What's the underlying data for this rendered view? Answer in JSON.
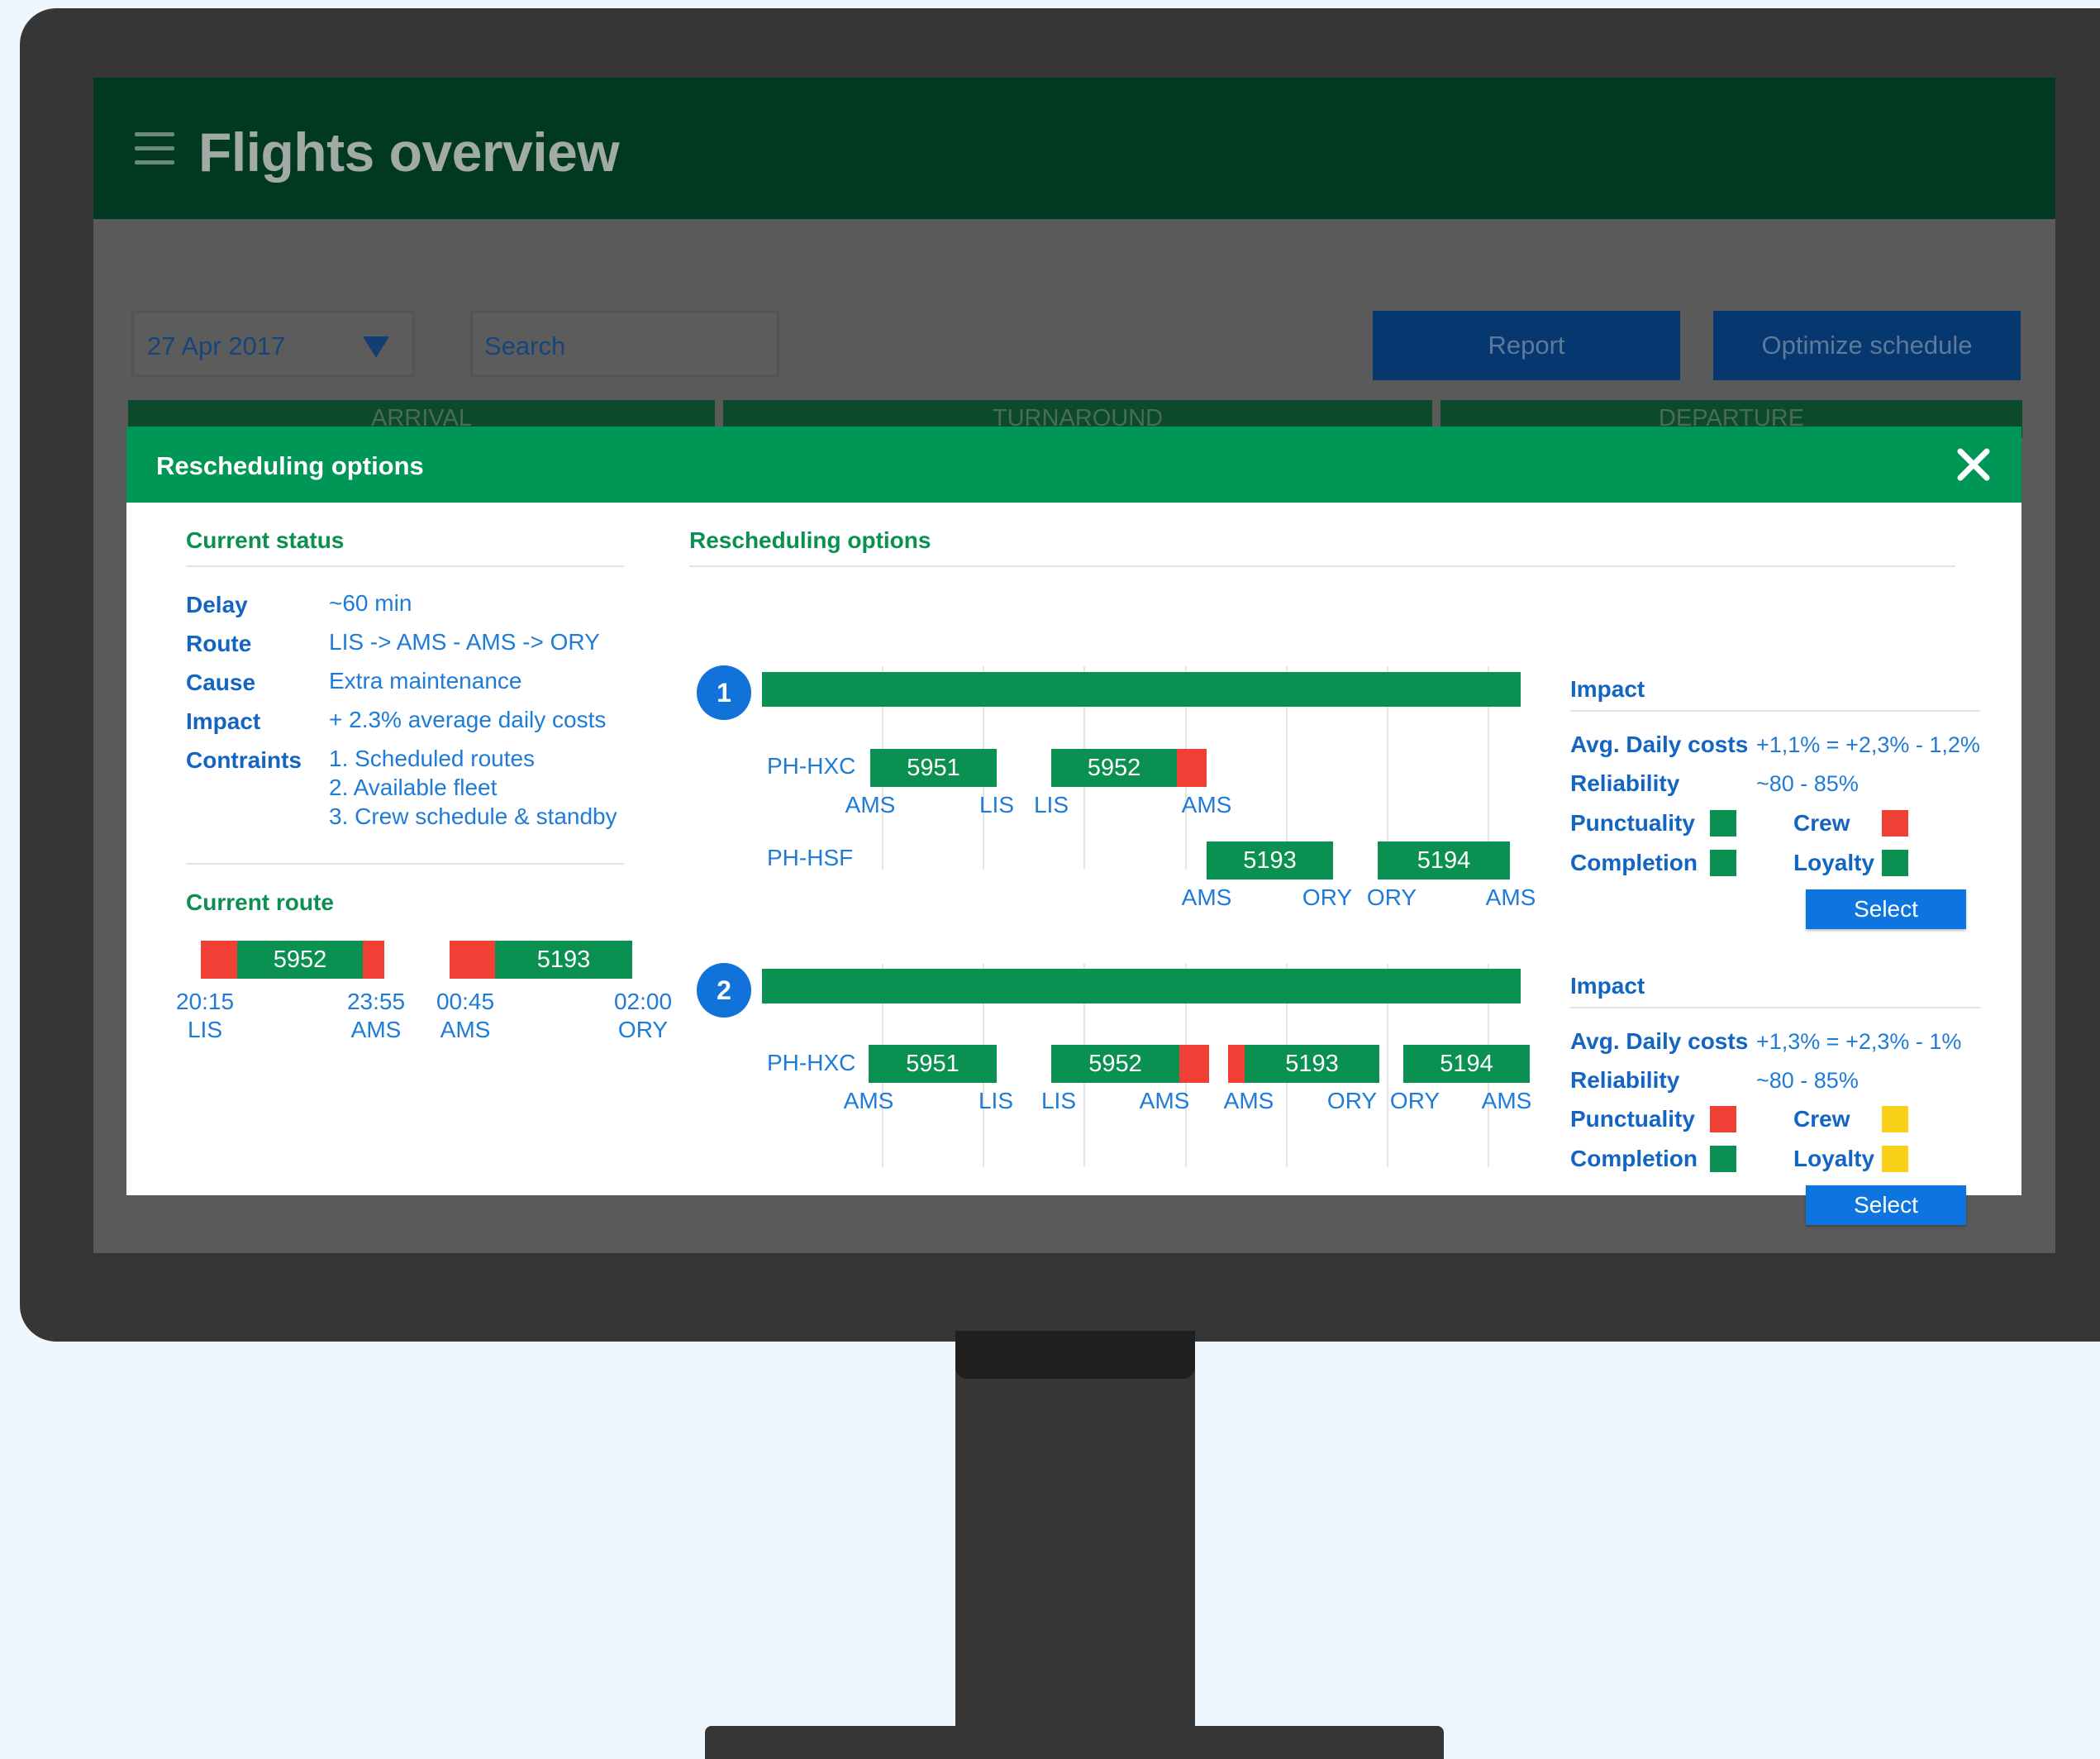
{
  "app": {
    "title": "Flights overview",
    "date_value": "27 Apr 2017",
    "search_placeholder": "Search",
    "report_label": "Report",
    "optimize_label": "Optimize schedule",
    "column_headers": [
      "ARRIVAL",
      "TURNAROUND",
      "DEPARTURE"
    ]
  },
  "modal": {
    "title": "Rescheduling options",
    "current_status": {
      "title": "Current status",
      "rows": [
        {
          "label": "Delay",
          "value": "~60 min"
        },
        {
          "label": "Route",
          "value": "LIS -> AMS - AMS -> ORY"
        },
        {
          "label": "Cause",
          "value": "Extra maintenance"
        },
        {
          "label": "Impact",
          "value": "+ 2.3% average daily costs"
        },
        {
          "label": "Contraints",
          "value": "1. Scheduled routes"
        }
      ],
      "constraints_extra": [
        "2. Available fleet",
        "3. Crew schedule & standby"
      ]
    },
    "current_route": {
      "title": "Current route",
      "flights": [
        "5952",
        "5193"
      ],
      "times": [
        "20:15",
        "23:55",
        "00:45",
        "02:00"
      ],
      "airports": [
        "LIS",
        "AMS",
        "AMS",
        "ORY"
      ]
    },
    "options_title": "Rescheduling options",
    "options": [
      {
        "number": "1",
        "aircraft": [
          "PH-HXC",
          "PH-HSF"
        ],
        "row1_flights": [
          "5951",
          "5952"
        ],
        "row1_airports": [
          "AMS",
          "LIS",
          "LIS",
          "AMS"
        ],
        "row2_flights": [
          "5193",
          "5194"
        ],
        "row2_airports": [
          "AMS",
          "ORY",
          "ORY",
          "AMS"
        ],
        "impact": {
          "title": "Impact",
          "avg_label": "Avg. Daily costs",
          "avg_value": "+1,1% = +2,3% - 1,2%",
          "reliability_label": "Reliability",
          "reliability_value": "~80 - 85%",
          "punctuality_label": "Punctuality",
          "crew_label": "Crew",
          "completion_label": "Completion",
          "loyalty_label": "Loyalty",
          "punctuality_color": "#0a9050",
          "crew_color": "#f04035",
          "completion_color": "#0a9050",
          "loyalty_color": "#0a9050",
          "select_label": "Select"
        }
      },
      {
        "number": "2",
        "aircraft": [
          "PH-HXC"
        ],
        "row1_flights": [
          "5951",
          "5952",
          "5193",
          "5194"
        ],
        "row1_airports": [
          "AMS",
          "LIS",
          "LIS",
          "AMS",
          "AMS",
          "ORY",
          "ORY",
          "AMS"
        ],
        "impact": {
          "title": "Impact",
          "avg_label": "Avg. Daily costs",
          "avg_value": "+1,3% = +2,3% - 1%",
          "reliability_label": "Reliability",
          "reliability_value": "~80 - 85%",
          "punctuality_label": "Punctuality",
          "crew_label": "Crew",
          "completion_label": "Completion",
          "loyalty_label": "Loyalty",
          "punctuality_color": "#f04035",
          "crew_color": "#f7d217",
          "completion_color": "#0a9050",
          "loyalty_color": "#f7d217",
          "select_label": "Select"
        }
      }
    ]
  }
}
